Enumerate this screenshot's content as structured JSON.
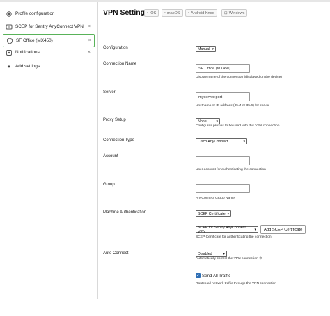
{
  "sidebar": {
    "items": [
      {
        "label": "Profile configuration",
        "icon": "gear-icon"
      },
      {
        "label": "SCEP for Sentry AnyConnect VPN",
        "icon": "certificate-icon",
        "remove": "×"
      },
      {
        "label": "SF Office (MX450)",
        "icon": "shield-icon",
        "remove": "×",
        "selected": true
      },
      {
        "label": "Notifications",
        "icon": "bell-icon",
        "remove": "×"
      }
    ],
    "add_label": "Add settings",
    "add_icon": "+"
  },
  "page": {
    "title": "VPN Settings",
    "os_tabs": [
      "iOS",
      "macOS",
      "Android Knox",
      "Windows"
    ]
  },
  "fields": {
    "configuration": {
      "label": "Configuration",
      "value": "Manual"
    },
    "connection_name": {
      "label": "Connection Name",
      "value": "SF Office (MX450)",
      "hint": "Display name of the connection (displayed on the device)"
    },
    "server": {
      "label": "Server",
      "value": "myserver:port",
      "hint": "Hostname or IP address (IPv4 or IPv6) for server"
    },
    "proxy_setup": {
      "label": "Proxy Setup",
      "value": "None",
      "hint": "Configures proxies to be used with this VPN connection"
    },
    "connection_type": {
      "label": "Connection Type",
      "value": "Cisco AnyConnect"
    },
    "account": {
      "label": "Account",
      "value": "",
      "hint": "User account for authenticating the connection"
    },
    "group": {
      "label": "Group",
      "value": "",
      "hint": "AnyConnect Group Name"
    },
    "machine_auth": {
      "label": "Machine Authentication",
      "value": "SCEP Certificate",
      "cert_value": "SCEP for Sentry AnyConnect VPN",
      "add_button": "Add SCEP Certificate",
      "hint": "SCEP Certificate for authenticating the connection"
    },
    "auto_connect": {
      "label": "Auto Connect",
      "value": "Disabled",
      "hint": "Automatically control the VPN connection ⊘"
    },
    "send_all_traffic": {
      "label": "Send All Traffic",
      "checked": true,
      "hint": "Routes all network traffic through the VPN connection"
    }
  },
  "colors": {
    "selected_border": "#59b259",
    "checkbox": "#2f6fb5"
  }
}
